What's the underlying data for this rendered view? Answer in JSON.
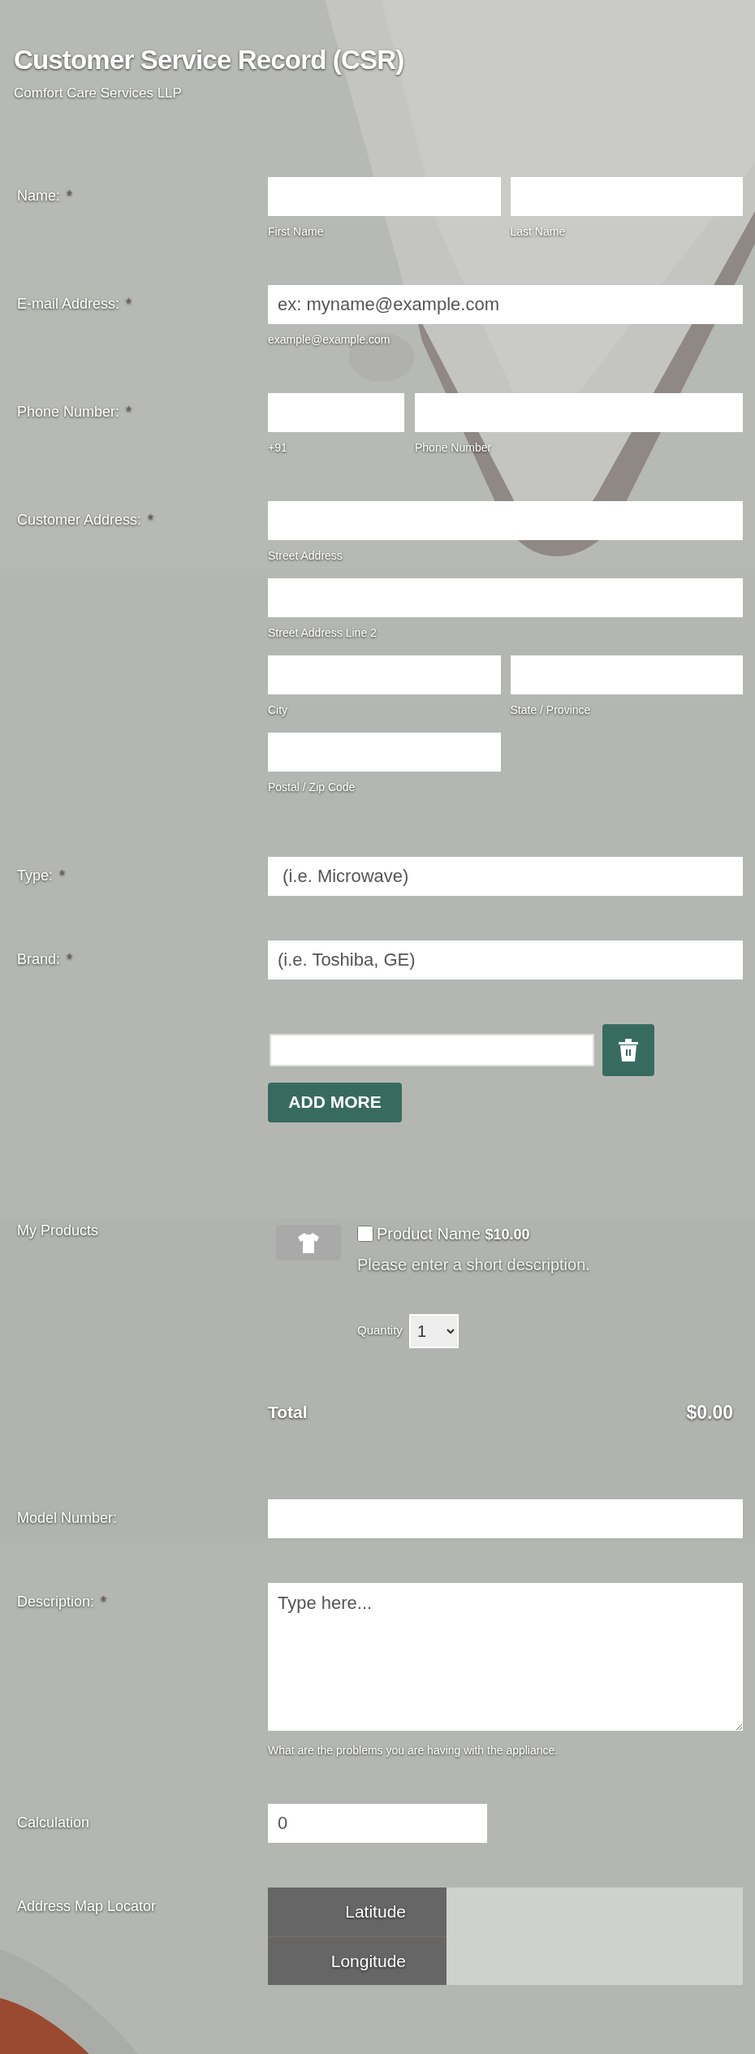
{
  "header": {
    "title": "Customer Service Record (CSR)",
    "subtitle": "Comfort Care Services LLP"
  },
  "fields": [
    {
      "kind": "pair",
      "label": "Name:",
      "marker": "*",
      "inputs": [
        {
          "sublabel": "First Name"
        },
        {
          "sublabel": "Last Name"
        }
      ]
    },
    {
      "kind": "email",
      "label": "E-mail Address:",
      "marker": "*",
      "placeholder": "ex: myname@example.com",
      "sublabel": "example@example.com"
    },
    {
      "kind": "phone",
      "label": "Phone Number:",
      "marker": "*",
      "inputs": [
        {
          "sublabel": "+91"
        },
        {
          "sublabel": "Phone Number"
        }
      ]
    },
    {
      "kind": "address",
      "label": "Customer Address:",
      "marker": "*",
      "inputs": [
        {
          "sublabel": "Street Address"
        },
        {
          "sublabel": "Street Address Line 2"
        },
        {
          "sublabel": "City"
        },
        {
          "sublabel": "State / Province"
        },
        {
          "sublabel": "Postal / Zip Code"
        }
      ]
    },
    {
      "kind": "text",
      "label": "Type:",
      "marker": "*",
      "placeholder": " (i.e. Microwave)"
    },
    {
      "kind": "text",
      "label": "Brand:",
      "marker": "*",
      "placeholder": "(i.e. Toshiba, GE)"
    },
    {
      "kind": "repeater",
      "button": "ADD MORE"
    },
    {
      "kind": "products",
      "label": "My Products",
      "products": [
        {
          "name": "Product Name",
          "price": "$10.00",
          "description": "Please enter a short description.",
          "checked": false,
          "quantity_label": "Quantity",
          "quantity": "1"
        }
      ],
      "total_label": "Total",
      "total": "$0.00"
    },
    {
      "kind": "text",
      "label": "Model Number:"
    },
    {
      "kind": "textarea",
      "label": "Description:",
      "marker": "*",
      "placeholder": "Type here...",
      "sublabel": "What are the problems you are having with the appliance."
    },
    {
      "kind": "number",
      "label": "Calculation",
      "value": "0"
    },
    {
      "kind": "map",
      "label": "Address Map Locator",
      "coordinates": [
        "Latitude",
        "Longitude"
      ]
    }
  ]
}
